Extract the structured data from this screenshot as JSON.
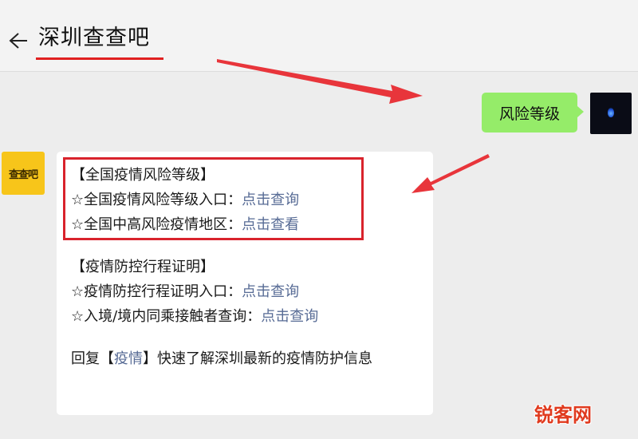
{
  "header": {
    "title": "深圳查查吧",
    "menu_glyph": "⋮"
  },
  "messages": {
    "user": {
      "text": "风险等级"
    },
    "bot": {
      "avatar_text": "查查吧",
      "lines": [
        {
          "text": "【全国疫情风险等级】"
        },
        {
          "prefix": "☆全国疫情风险等级入口：",
          "link": "点击查询"
        },
        {
          "prefix": "☆全国中高风险疫情地区：",
          "link": "点击查看"
        },
        {
          "text": "【疫情防控行程证明】"
        },
        {
          "prefix": "☆疫情防控行程证明入口：",
          "link": "点击查询"
        },
        {
          "prefix": "☆入境/境内同乘接触者查询：",
          "link": "点击查询"
        },
        {
          "before": "回复【",
          "keyword": "疫情",
          "after": "】快速了解深圳最新的疫情防护信息"
        }
      ]
    }
  },
  "watermark": {
    "text": "锐客网"
  },
  "colors": {
    "user_bubble": "#95ec69",
    "link": "#576b95",
    "highlight": "#d9232c",
    "arrow": "#e8353b"
  }
}
